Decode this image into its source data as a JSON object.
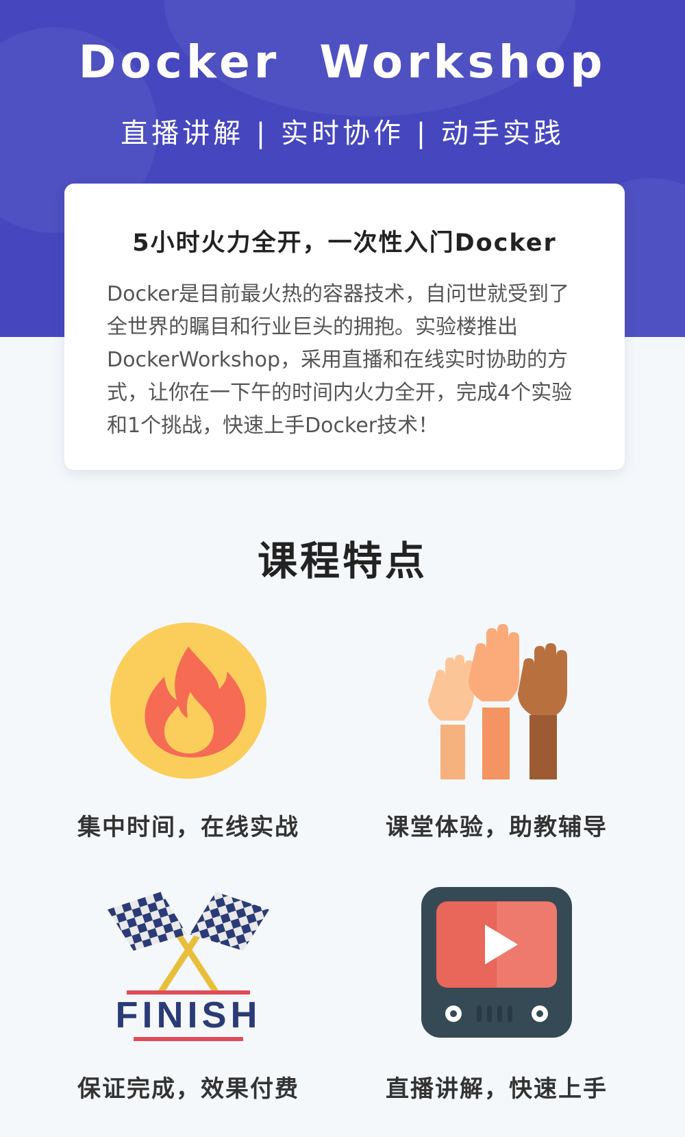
{
  "hero": {
    "title": "Docker Workshop",
    "subtitle": "直播讲解 | 实时协作 | 动手实践",
    "background_color": "#4647be"
  },
  "intro_card": {
    "title": "5小时火力全开，一次性入门Docker",
    "body": "Docker是目前最火热的容器技术，自问世就受到了全世界的瞩目和行业巨头的拥抱。实验楼推出DockerWorkshop，采用直播和在线实时协助的方式，让你在一下午的时间内火力全开，完成4个实验和1个挑战，快速上手Docker技术！"
  },
  "features_section": {
    "title": "课程特点",
    "items": [
      {
        "label": "集中时间，在线实战",
        "icon": "fire-icon"
      },
      {
        "label": "课堂体验，助教辅导",
        "icon": "raised-hands-icon"
      },
      {
        "label": "保证完成，效果付费",
        "icon": "finish-flags-icon"
      },
      {
        "label": "直播讲解，快速上手",
        "icon": "video-play-icon"
      }
    ]
  },
  "finish_badge_text": "FINISH"
}
